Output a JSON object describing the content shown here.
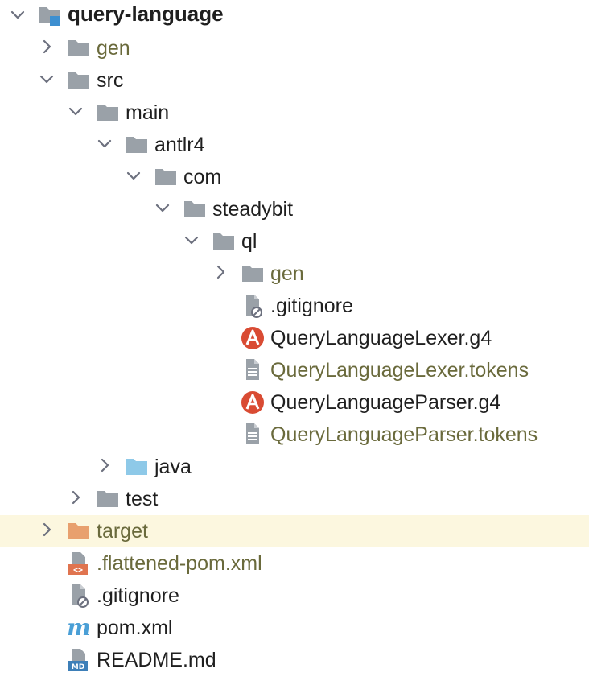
{
  "colors": {
    "text_default": "#1f1f1f",
    "text_excluded": "#6a6a3c",
    "folder_gray": "#9aa1a8",
    "folder_source_blue": "#8ec9e8",
    "folder_target_orange": "#e8a06e",
    "antlr_red": "#d94b33",
    "selected_row_bg": "#fcf7df",
    "module_blue": "#3d8fd0"
  },
  "tree": [
    {
      "label": "query-language",
      "depth": 0,
      "expandable": true,
      "expanded": true,
      "icon": "module-folder-icon",
      "color": "default",
      "bold": true
    },
    {
      "label": "gen",
      "depth": 1,
      "expandable": true,
      "expanded": false,
      "icon": "folder-icon",
      "color": "excluded"
    },
    {
      "label": "src",
      "depth": 1,
      "expandable": true,
      "expanded": true,
      "icon": "folder-icon",
      "color": "default"
    },
    {
      "label": "main",
      "depth": 2,
      "expandable": true,
      "expanded": true,
      "icon": "folder-icon",
      "color": "default"
    },
    {
      "label": "antlr4",
      "depth": 3,
      "expandable": true,
      "expanded": true,
      "icon": "folder-icon",
      "color": "default"
    },
    {
      "label": "com",
      "depth": 4,
      "expandable": true,
      "expanded": true,
      "icon": "folder-icon",
      "color": "default"
    },
    {
      "label": "steadybit",
      "depth": 5,
      "expandable": true,
      "expanded": true,
      "icon": "folder-icon",
      "color": "default"
    },
    {
      "label": "ql",
      "depth": 6,
      "expandable": true,
      "expanded": true,
      "icon": "folder-icon",
      "color": "default"
    },
    {
      "label": "gen",
      "depth": 7,
      "expandable": true,
      "expanded": false,
      "icon": "folder-icon",
      "color": "excluded"
    },
    {
      "label": ".gitignore",
      "depth": 7,
      "expandable": false,
      "icon": "ignore-file-icon",
      "color": "default"
    },
    {
      "label": "QueryLanguageLexer.g4",
      "depth": 7,
      "expandable": false,
      "icon": "antlr-icon",
      "color": "default"
    },
    {
      "label": "QueryLanguageLexer.tokens",
      "depth": 7,
      "expandable": false,
      "icon": "text-file-icon",
      "color": "excluded"
    },
    {
      "label": "QueryLanguageParser.g4",
      "depth": 7,
      "expandable": false,
      "icon": "antlr-icon",
      "color": "default"
    },
    {
      "label": "QueryLanguageParser.tokens",
      "depth": 7,
      "expandable": false,
      "icon": "text-file-icon",
      "color": "excluded"
    },
    {
      "label": "java",
      "depth": 3,
      "expandable": true,
      "expanded": false,
      "icon": "source-folder-icon",
      "color": "default"
    },
    {
      "label": "test",
      "depth": 2,
      "expandable": true,
      "expanded": false,
      "icon": "folder-icon",
      "color": "default"
    },
    {
      "label": "target",
      "depth": 1,
      "expandable": true,
      "expanded": false,
      "icon": "excluded-folder-icon",
      "color": "excluded",
      "selected": true
    },
    {
      "label": ".flattened-pom.xml",
      "depth": 1,
      "expandable": false,
      "icon": "xml-file-icon",
      "color": "excluded"
    },
    {
      "label": ".gitignore",
      "depth": 1,
      "expandable": false,
      "icon": "ignore-file-icon",
      "color": "default"
    },
    {
      "label": "pom.xml",
      "depth": 1,
      "expandable": false,
      "icon": "maven-icon",
      "color": "default"
    },
    {
      "label": "README.md",
      "depth": 1,
      "expandable": false,
      "icon": "markdown-file-icon",
      "color": "default"
    }
  ]
}
